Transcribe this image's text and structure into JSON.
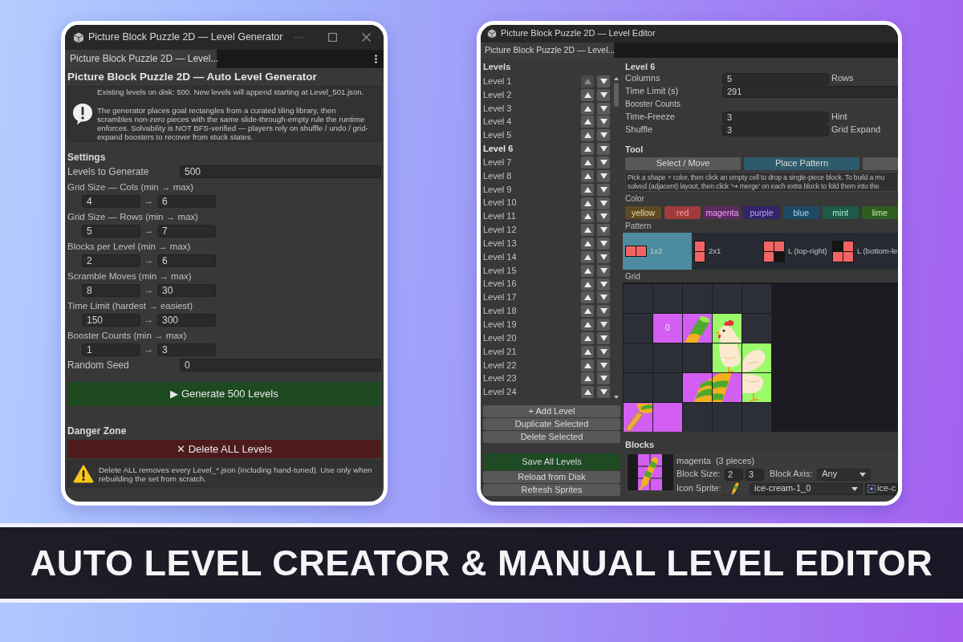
{
  "generator": {
    "title": "Picture Block Puzzle 2D — Level Generator",
    "tab": {
      "label": "Picture Block Puzzle 2D — Level...",
      "selected": true
    },
    "heading": "Picture Block Puzzle 2D — Auto Level Generator",
    "info": [
      "Existing levels on disk: 500. New levels will append starting at Level_501.json.",
      "The generator places goal rectangles from a curated tiling library, then scrambles non-zero pieces with the same slide-through-empty rule the runtime enforces. Solvability is NOT BFS-verified — players rely on shuffle / undo / grid-expand boosters to recover from stuck states."
    ],
    "settings_title": "Settings",
    "fields": [
      {
        "kind": "single",
        "label": "Levels to Generate",
        "value": "500"
      },
      {
        "kind": "range",
        "label": "Grid Size — Cols (min → max)",
        "min": "4",
        "separator": "→",
        "max": "6"
      },
      {
        "kind": "range",
        "label": "Grid Size — Rows (min → max)",
        "min": "5",
        "separator": "→",
        "max": "7"
      },
      {
        "kind": "range",
        "label": "Blocks per Level (min → max)",
        "min": "2",
        "separator": "→",
        "max": "6"
      },
      {
        "kind": "range",
        "label": "Scramble Moves (min → max)",
        "min": "8",
        "separator": "→",
        "max": "30"
      },
      {
        "kind": "range",
        "label": "Time Limit (hardest → easiest)",
        "min": "150",
        "separator": "→",
        "max": "300"
      },
      {
        "kind": "range",
        "label": "Booster Counts (min → max)",
        "min": "1",
        "separator": "→",
        "max": "3"
      },
      {
        "kind": "single",
        "label": "Random Seed",
        "value": "0"
      }
    ],
    "generate_button": "▶ Generate 500 Levels",
    "danger_title": "Danger Zone",
    "delete_button": "✕ Delete ALL Levels",
    "warning": "Delete ALL removes every Level_*.json (including hand-tuned). Use only when rebuilding the set from scratch."
  },
  "editor": {
    "title": "Picture Block Puzzle 2D — Level Editor",
    "tab": {
      "label": "Picture Block Puzzle 2D — Level...",
      "selected": true
    },
    "levels_title": "Levels",
    "levels": [
      {
        "label": "Level 1",
        "selected": false,
        "up_disabled": true
      },
      {
        "label": "Level 2",
        "selected": false,
        "up_disabled": false
      },
      {
        "label": "Level 3",
        "selected": false,
        "up_disabled": false
      },
      {
        "label": "Level 4",
        "selected": false,
        "up_disabled": false
      },
      {
        "label": "Level 5",
        "selected": false,
        "up_disabled": false
      },
      {
        "label": "Level 6",
        "selected": true,
        "up_disabled": false
      },
      {
        "label": "Level 7",
        "selected": false,
        "up_disabled": false
      },
      {
        "label": "Level 8",
        "selected": false,
        "up_disabled": false
      },
      {
        "label": "Level 9",
        "selected": false,
        "up_disabled": false
      },
      {
        "label": "Level 10",
        "selected": false,
        "up_disabled": false
      },
      {
        "label": "Level 11",
        "selected": false,
        "up_disabled": false
      },
      {
        "label": "Level 12",
        "selected": false,
        "up_disabled": false
      },
      {
        "label": "Level 13",
        "selected": false,
        "up_disabled": false
      },
      {
        "label": "Level 14",
        "selected": false,
        "up_disabled": false
      },
      {
        "label": "Level 15",
        "selected": false,
        "up_disabled": false
      },
      {
        "label": "Level 16",
        "selected": false,
        "up_disabled": false
      },
      {
        "label": "Level 17",
        "selected": false,
        "up_disabled": false
      },
      {
        "label": "Level 18",
        "selected": false,
        "up_disabled": false
      },
      {
        "label": "Level 19",
        "selected": false,
        "up_disabled": false
      },
      {
        "label": "Level 20",
        "selected": false,
        "up_disabled": false
      },
      {
        "label": "Level 21",
        "selected": false,
        "up_disabled": false
      },
      {
        "label": "Level 22",
        "selected": false,
        "up_disabled": false
      },
      {
        "label": "Level 23",
        "selected": false,
        "up_disabled": false
      },
      {
        "label": "Level 24",
        "selected": false,
        "up_disabled": false
      }
    ],
    "list_buttons": [
      "+ Add Level",
      "Duplicate Selected",
      "Delete Selected"
    ],
    "save_button": "Save All Levels",
    "file_buttons": [
      "Reload from Disk",
      "Refresh Sprites"
    ],
    "detail_title": "Level 6",
    "properties": [
      {
        "kind": "field",
        "label": "Columns",
        "value": "5",
        "side_label": "Rows"
      },
      {
        "kind": "wide",
        "label": "Time Limit (s)",
        "value": "291"
      },
      {
        "kind": "caption",
        "label": "Booster Counts"
      },
      {
        "kind": "field",
        "label": "Time-Freeze",
        "value": "3",
        "side_label": "Hint"
      },
      {
        "kind": "field",
        "label": "Shuffle",
        "value": "3",
        "side_label": "Grid Expand"
      }
    ],
    "tool_title": "Tool",
    "tools": [
      {
        "label": "Select / Move",
        "selected": false
      },
      {
        "label": "Place Pattern",
        "selected": true
      },
      {
        "selected": false
      }
    ],
    "hint_lines": [
      "Pick a shape + color, then click an empty cell to drop a single-piece block. To build a mu",
      "solved (adjacent) layout, then click '↪ merge' on each extra block to fold them into the"
    ],
    "color_title": "Color",
    "colors": [
      {
        "label": "yellow",
        "color": "#5e4b24"
      },
      {
        "label": "red",
        "color": "#a23b3b"
      },
      {
        "label": "magenta",
        "color": "#5b2b5e"
      },
      {
        "label": "purple",
        "color": "#34246a"
      },
      {
        "label": "blue",
        "color": "#1f4a67"
      },
      {
        "label": "mint",
        "color": "#1e5a47"
      },
      {
        "label": "lime",
        "color": "#2f5c1f"
      }
    ],
    "pattern_title": "Pattern",
    "patterns": [
      {
        "label": "1x2",
        "selected": true,
        "cells": [
          [
            true,
            true
          ]
        ]
      },
      {
        "label": "2x1",
        "selected": false,
        "cells": [
          [
            true
          ],
          [
            true
          ]
        ]
      },
      {
        "label": "L (top-right)",
        "selected": false,
        "cells": [
          [
            true,
            true
          ],
          [
            true,
            false
          ]
        ]
      },
      {
        "label": "L (bottom-le",
        "selected": false,
        "cells": [
          [
            false,
            true
          ],
          [
            true,
            true
          ]
        ]
      }
    ],
    "grid_title": "Grid",
    "grid": {
      "rows": [
        [
          {
            "kind": "empty"
          },
          {
            "kind": "empty"
          },
          {
            "kind": "empty"
          },
          {
            "kind": "empty"
          },
          {
            "kind": "empty"
          }
        ],
        [
          {
            "kind": "empty"
          },
          {
            "kind": "plain",
            "color": "#d35ef2",
            "label": "0"
          },
          {
            "kind": "ice-cream-top",
            "color": "#d35ef2"
          },
          {
            "kind": "chicken-head",
            "color": "#9bfa6a"
          },
          {
            "kind": "empty"
          }
        ],
        [
          {
            "kind": "empty"
          },
          {
            "kind": "empty"
          },
          {
            "kind": "empty"
          },
          {
            "kind": "chicken-body",
            "color": "#9bfa6a"
          },
          {
            "kind": "chicken-tail",
            "color": "#9bfa6a"
          }
        ],
        [
          {
            "kind": "empty"
          },
          {
            "kind": "empty"
          },
          {
            "kind": "ice-cream-twist",
            "color": "#d35ef2"
          },
          {
            "kind": "ice-cream-swirl",
            "color": "#d35ef2"
          },
          {
            "kind": "chicken-legs",
            "color": "#9bfa6a"
          }
        ],
        [
          {
            "kind": "ice-cream-stick",
            "color": "#d35ef2"
          },
          {
            "kind": "plain",
            "color": "#d35ef2"
          },
          {
            "kind": "empty"
          },
          {
            "kind": "empty"
          },
          {
            "kind": "empty"
          }
        ]
      ]
    },
    "blocks_title": "Blocks",
    "block": {
      "name": "magenta  (3 pieces)",
      "size_label": "Block Size:",
      "size": [
        "2",
        "3"
      ],
      "axis_label": "Block Axis:",
      "axis": "Any",
      "sprite_label": "Icon Sprite:",
      "sprite": "ice-cream-1_0",
      "sprite_object": "ice-c"
    }
  },
  "banner": {
    "text": "AUTO LEVEL CREATOR & MANUAL LEVEL EDITOR"
  }
}
